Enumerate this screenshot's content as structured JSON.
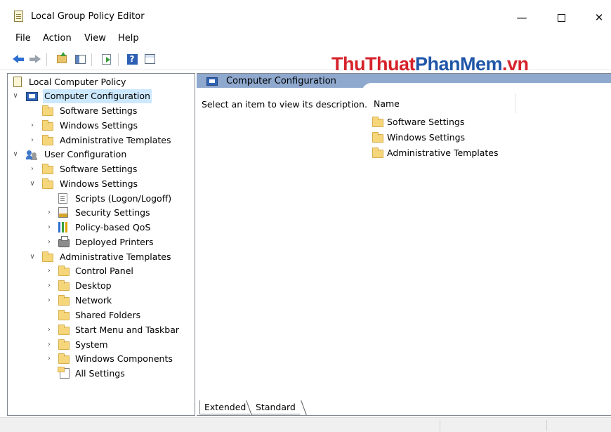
{
  "window": {
    "title": "Local Group Policy Editor",
    "minimize_glyph": "—",
    "close_glyph": "✕"
  },
  "menu": [
    "File",
    "Action",
    "View",
    "Help"
  ],
  "toolbar": {
    "icons": [
      "back-arrow-icon",
      "forward-arrow-icon",
      "up-folder-icon",
      "show-hide-tree-icon",
      "export-list-icon",
      "help-icon",
      "properties-icon"
    ],
    "help_glyph": "?"
  },
  "watermark": {
    "part1": "ThuThuat",
    "part2": "PhanMem",
    "part3": ".vn",
    "colors": {
      "red": "#d6222a",
      "blue": "#1f56a8"
    }
  },
  "tree": {
    "root": "Local Computer Policy",
    "computer_configuration": "Computer Configuration",
    "cc_software_settings": "Software Settings",
    "cc_windows_settings": "Windows Settings",
    "cc_administrative_templates": "Administrative Templates",
    "user_configuration": "User Configuration",
    "uc_software_settings": "Software Settings",
    "uc_windows_settings": "Windows Settings",
    "scripts": "Scripts (Logon/Logoff)",
    "security_settings": "Security Settings",
    "policy_qos": "Policy-based QoS",
    "deployed_printers": "Deployed Printers",
    "uc_administrative_templates": "Administrative Templates",
    "control_panel": "Control Panel",
    "desktop": "Desktop",
    "network": "Network",
    "shared_folders": "Shared Folders",
    "start_menu": "Start Menu and Taskbar",
    "system": "System",
    "windows_components": "Windows Components",
    "all_settings": "All Settings"
  },
  "right_pane": {
    "header_title": "Computer Configuration",
    "description": "Select an item to view its description.",
    "column_name": "Name",
    "items": [
      "Software Settings",
      "Windows Settings",
      "Administrative Templates"
    ],
    "header_color": "#8fa9ce"
  },
  "tabs": [
    "Extended",
    "Standard"
  ],
  "selection_color": "#cce8ff"
}
